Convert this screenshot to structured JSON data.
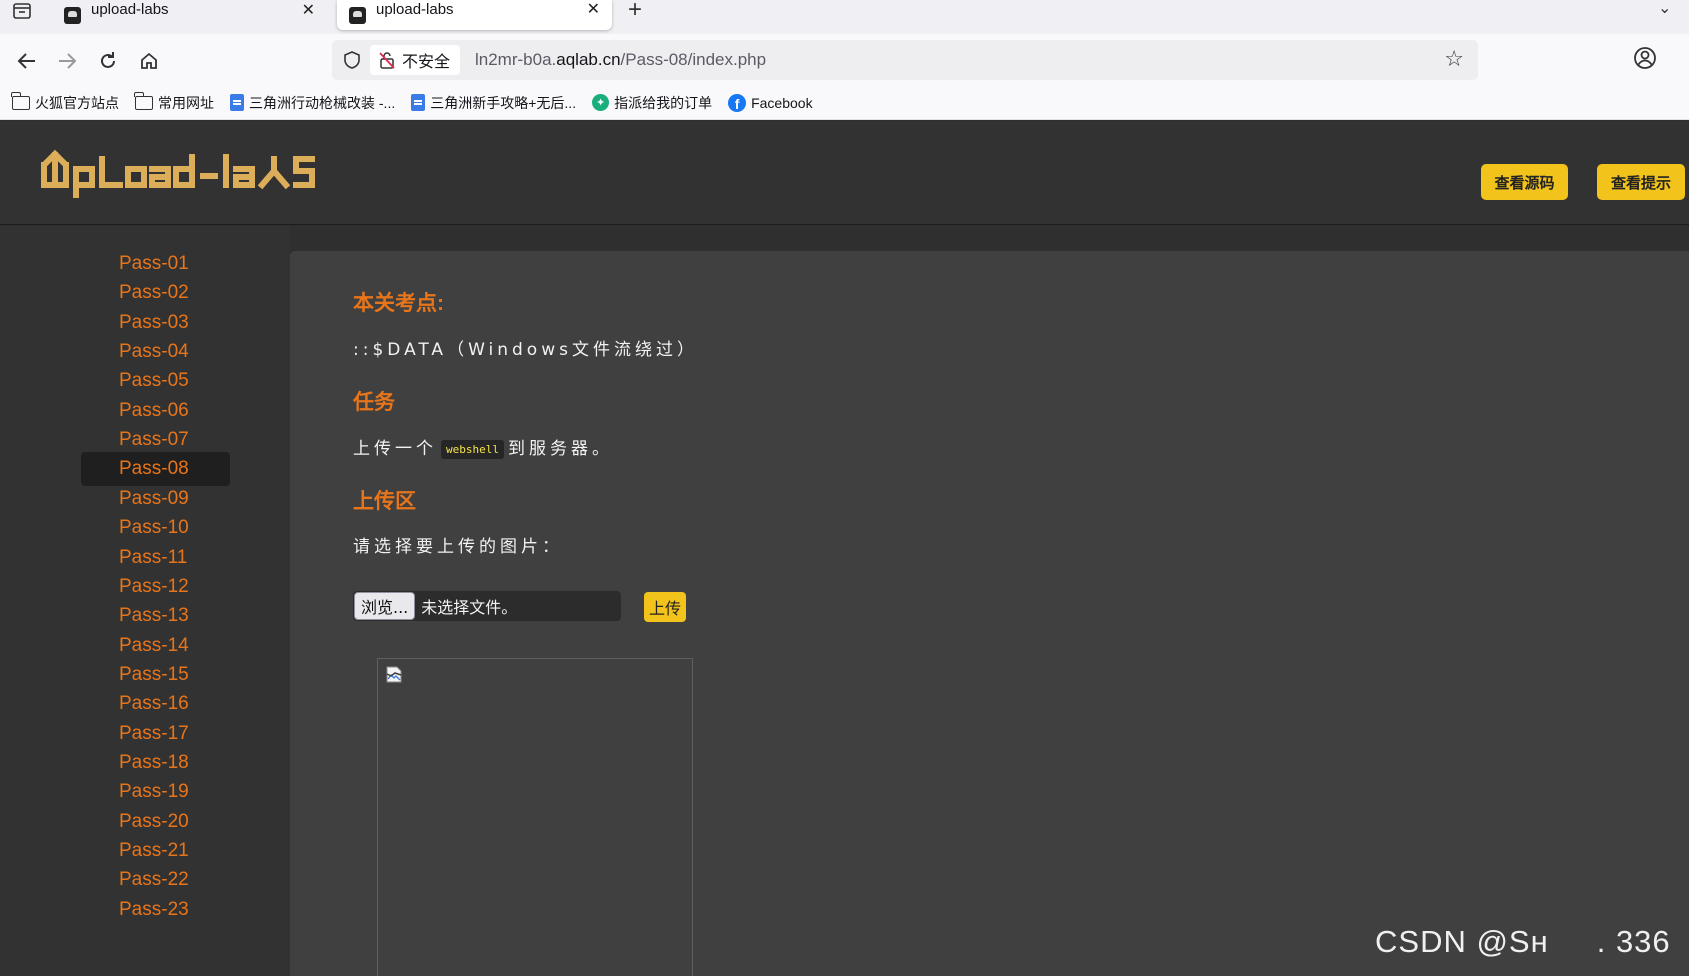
{
  "browser": {
    "tabs": [
      {
        "title": "upload-labs",
        "active": false
      },
      {
        "title": "upload-labs",
        "active": true
      }
    ],
    "url": {
      "security_label": "不安全",
      "prefix": "ln2mr-b0a.",
      "host": "aqlab.cn",
      "path": "/Pass-08/index.php"
    },
    "bookmarks": [
      {
        "label": "火狐官方站点",
        "icon": "folder-icon"
      },
      {
        "label": "常用网址",
        "icon": "folder-icon"
      },
      {
        "label": "三角洲行动枪械改装 -...",
        "icon": "doc-icon"
      },
      {
        "label": "三角洲新手攻略+无后...",
        "icon": "doc-icon"
      },
      {
        "label": "指派给我的订单",
        "icon": "green-app-icon"
      },
      {
        "label": "Facebook",
        "icon": "facebook-icon"
      }
    ]
  },
  "header": {
    "logo_text": "Upload-labs",
    "view_source_label": "查看源码",
    "view_hint_label": "查看提示"
  },
  "sidebar": {
    "active_index": 7,
    "items": [
      "Pass-01",
      "Pass-02",
      "Pass-03",
      "Pass-04",
      "Pass-05",
      "Pass-06",
      "Pass-07",
      "Pass-08",
      "Pass-09",
      "Pass-10",
      "Pass-11",
      "Pass-12",
      "Pass-13",
      "Pass-14",
      "Pass-15",
      "Pass-16",
      "Pass-17",
      "Pass-18",
      "Pass-19",
      "Pass-20",
      "Pass-21",
      "Pass-22",
      "Pass-23"
    ]
  },
  "main": {
    "topic_title": "本关考点:",
    "topic_text": "::$DATA（Windows文件流绕过）",
    "task_title": "任务",
    "task_before": "上传一个",
    "task_code": "webshell",
    "task_after": "到服务器。",
    "upload_title": "上传区",
    "upload_prompt": "请选择要上传的图片：",
    "browse_label": "浏览...",
    "file_status": "未选择文件。",
    "upload_label": "上传"
  },
  "watermark": {
    "left": "CSDN @Sн",
    "right": ". 336"
  },
  "colors": {
    "accent_orange": "#e8751a",
    "button_yellow": "#f2c31a",
    "page_bg": "#2f2f2f",
    "panel_bg": "#404040"
  }
}
